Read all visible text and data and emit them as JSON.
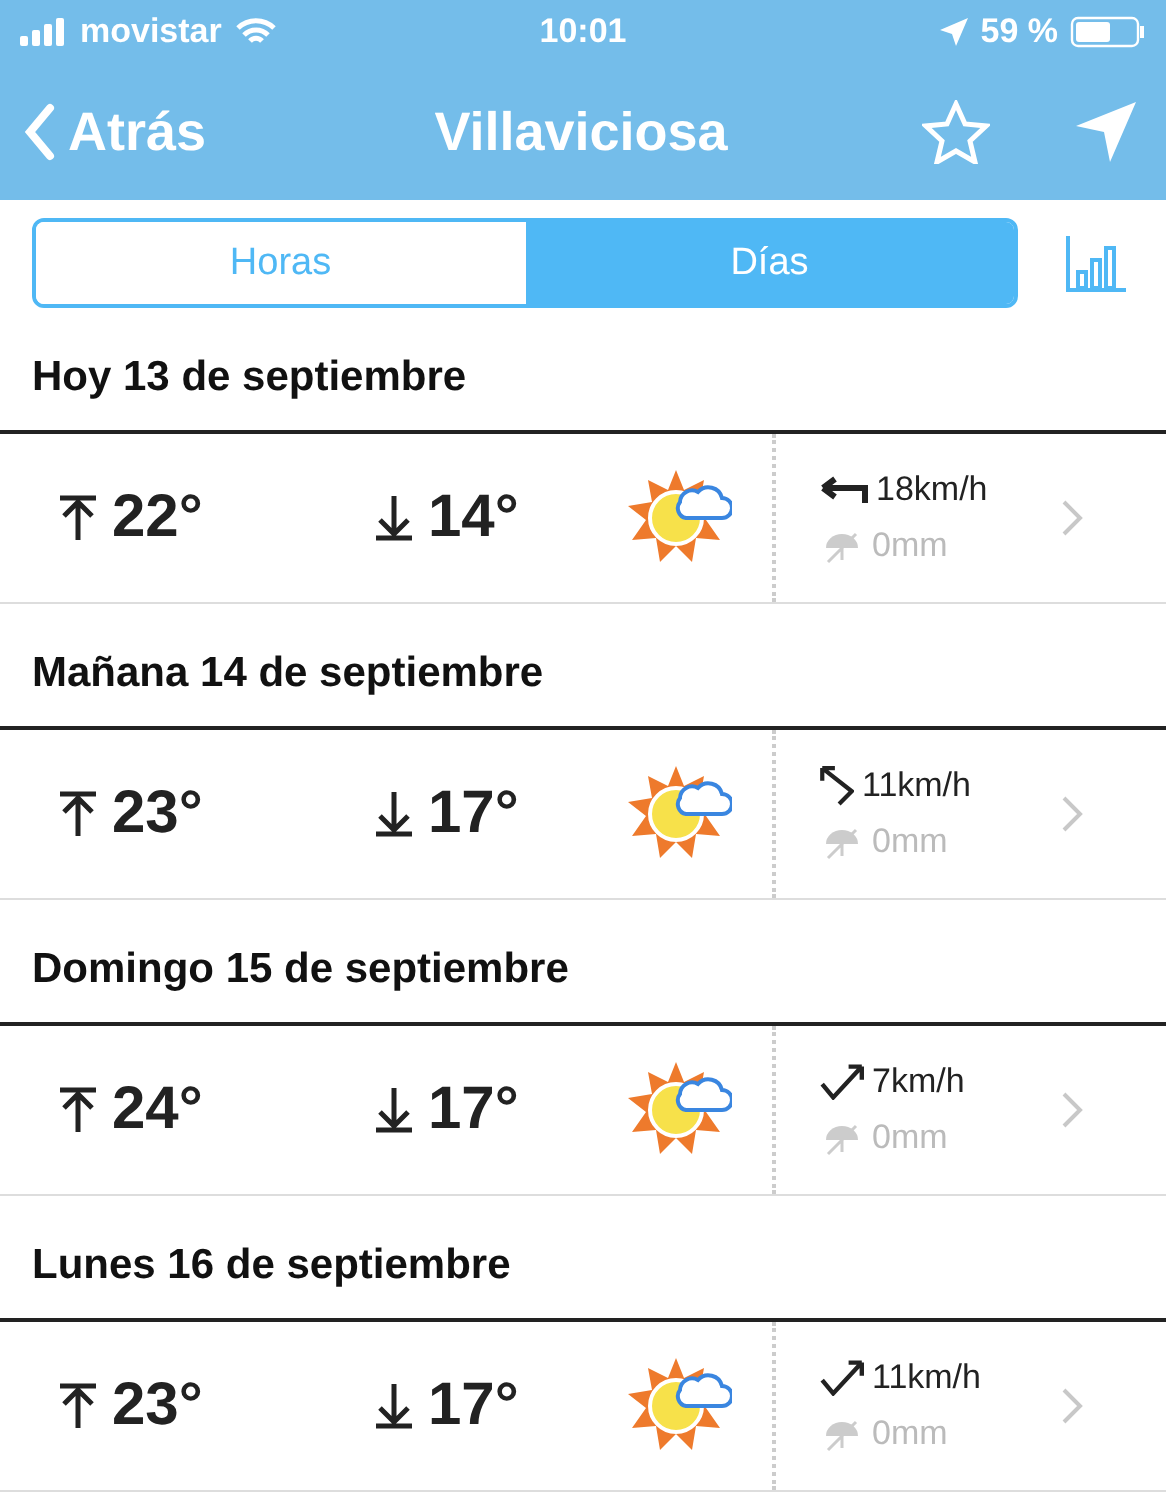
{
  "status_bar": {
    "carrier": "movistar",
    "time": "10:01",
    "battery": "59 %"
  },
  "nav": {
    "back": "Atrás",
    "title": "Villaviciosa"
  },
  "tabs": [
    {
      "label": "Horas",
      "selected": false
    },
    {
      "label": "Días",
      "selected": true
    }
  ],
  "days": [
    {
      "date": "Hoy 13 de septiembre",
      "high": "22°",
      "low": "14°",
      "wind": {
        "speed": "18km/h",
        "kind": "west"
      },
      "rain": "0mm"
    },
    {
      "date": "Mañana 14 de septiembre",
      "high": "23°",
      "low": "17°",
      "wind": {
        "speed": "11km/h",
        "kind": "northwest"
      },
      "rain": "0mm"
    },
    {
      "date": "Domingo 15 de septiembre",
      "high": "24°",
      "low": "17°",
      "wind": {
        "speed": "7km/h",
        "kind": "northeast"
      },
      "rain": "0mm"
    },
    {
      "date": "Lunes 16 de septiembre",
      "high": "23°",
      "low": "17°",
      "wind": {
        "speed": "11km/h",
        "kind": "northeast"
      },
      "rain": "0mm"
    }
  ]
}
